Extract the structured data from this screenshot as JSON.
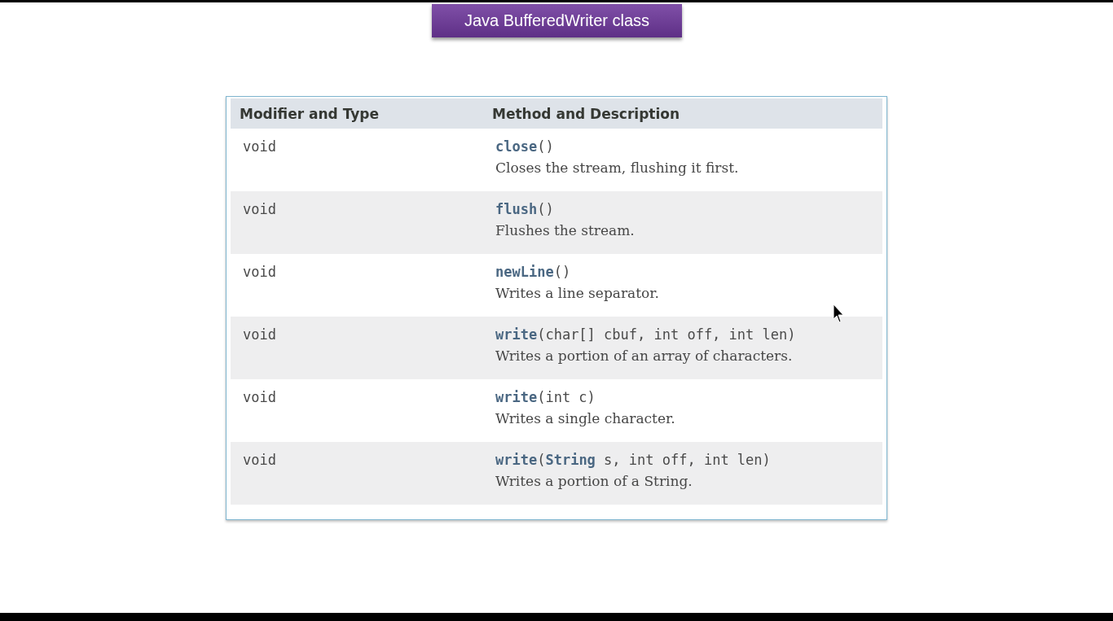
{
  "title": "Java BufferedWriter class",
  "table": {
    "columns": [
      "Modifier and Type",
      "Method and Description"
    ],
    "rows": [
      {
        "type": "void",
        "method": "**close**()",
        "description": "Closes the stream, flushing it first."
      },
      {
        "type": "void",
        "method": "**flush**()",
        "description": "Flushes the stream."
      },
      {
        "type": "void",
        "method": "**newLine**()",
        "description": "Writes a line separator."
      },
      {
        "type": "void",
        "method": "**write**(char[] cbuf, int off, int len)",
        "description": "Writes a portion of an array of characters."
      },
      {
        "type": "void",
        "method": "**write**(int c)",
        "description": "Writes a single character."
      },
      {
        "type": "void",
        "method": "**write**(**String** s, int off, int len)",
        "description": "Writes a portion of a String."
      }
    ]
  }
}
